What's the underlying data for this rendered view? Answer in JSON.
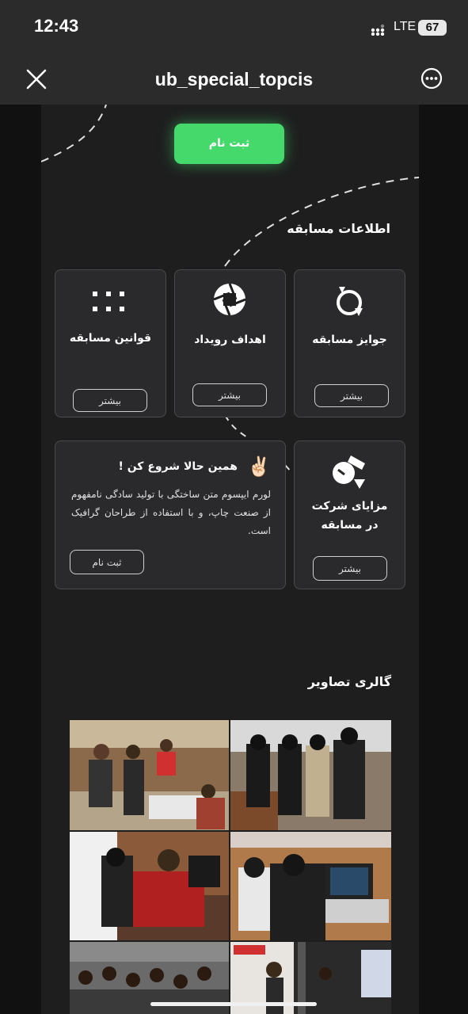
{
  "status_bar": {
    "time": "12:43",
    "network": "LTE",
    "battery": "67"
  },
  "top_bar": {
    "title": "ub_special_topcis"
  },
  "hero": {
    "register_label": "ثبت نام"
  },
  "competition_info": {
    "heading": "اطلاعات مسابقه",
    "cards": [
      {
        "title": "جوایز مسابقه",
        "button": "بیشتر",
        "icon": "prize-icon"
      },
      {
        "title": "اهداف رویداد",
        "button": "بیشتر",
        "icon": "aperture-icon"
      },
      {
        "title": "قوانین مسابقه",
        "button": "بیشتر",
        "icon": "dots-grid-icon"
      },
      {
        "title_line1": "مزایای شرکت",
        "title_line2": "در مسابقه",
        "button": "بیشتر",
        "icon": "benefits-icon"
      }
    ],
    "start_now": {
      "title": "همین حالا شروع کن !",
      "emoji": "✌🏻",
      "text": "لورم ایپسوم متن ساختگی با تولید سادگی نامفهوم از صنعت چاپ، و با استفاده از طراحان گرافیک است.",
      "button": "ثبت نام"
    }
  },
  "gallery": {
    "heading": "گالری تصاویر",
    "photo_count": 6
  }
}
